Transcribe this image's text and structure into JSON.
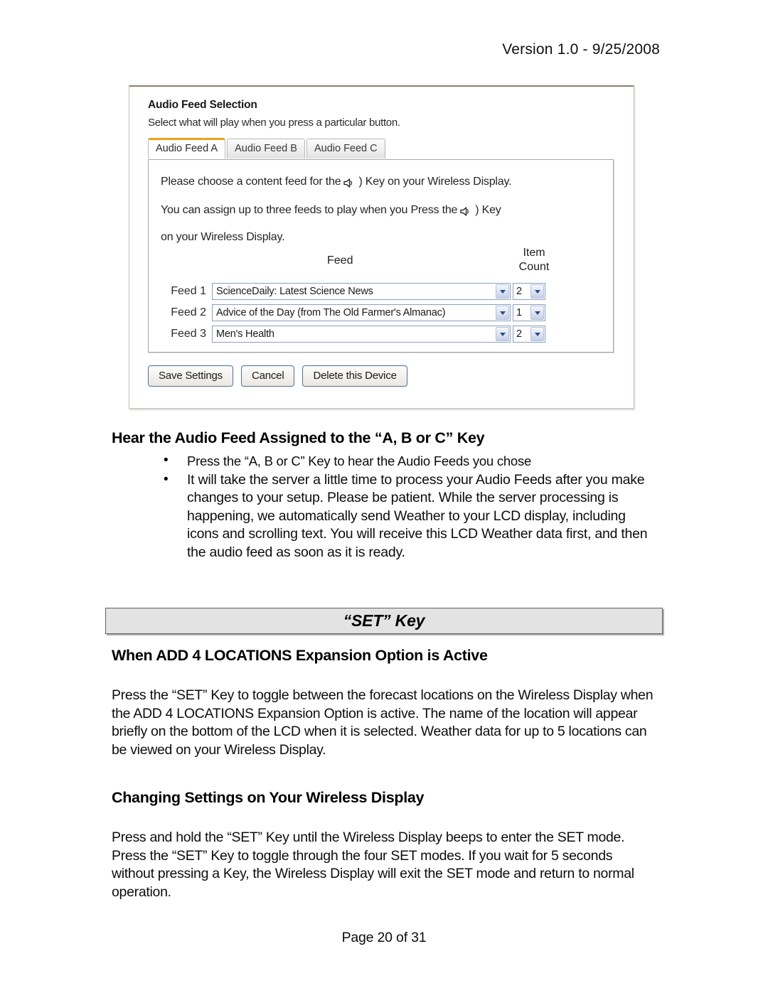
{
  "header": {
    "version_line": "Version 1.0 - 9/25/2008"
  },
  "screenshot_panel": {
    "title": "Audio Feed Selection",
    "subtitle": "Select what will play when you press a particular button.",
    "tabs": [
      {
        "label": "Audio Feed A",
        "active": true
      },
      {
        "label": "Audio Feed B",
        "active": false
      },
      {
        "label": "Audio Feed C",
        "active": false
      }
    ],
    "intro": {
      "line1_before": "Please choose a content feed for the",
      "line1_after": ") Key on your Wireless Display.",
      "line2_before": "You can assign up to three feeds to play when you Press the",
      "line2_after": ") Key",
      "line3": "on your Wireless Display."
    },
    "table": {
      "header_feed": "Feed",
      "header_count": "Item Count",
      "rows": [
        {
          "label": "Feed 1",
          "feed": "ScienceDaily: Latest Science News",
          "count": "2"
        },
        {
          "label": "Feed 2",
          "feed": "Advice of the Day (from The Old Farmer's Almanac)",
          "count": "1"
        },
        {
          "label": "Feed 3",
          "feed": "Men's Health",
          "count": "2"
        }
      ]
    },
    "buttons": {
      "save": "Save Settings",
      "cancel": "Cancel",
      "delete": "Delete this Device"
    },
    "colors": {
      "active_tab_accent": "#f0a11b",
      "panel_border": "#c9c4ae",
      "select_border": "#8ba0bf",
      "button_border": "#4f6f9c"
    }
  },
  "sections": {
    "audio_feed_heading": "Hear the Audio Feed Assigned to the “A, B or C” Key",
    "audio_feed_bullets": [
      "Press the “A, B or C” Key to hear the Audio Feeds  you chose",
      "It will take the server a little time to process your Audio Feeds after you make changes to your setup.  Please be patient.  While the server processing is happening, we automatically send Weather to your LCD display, including icons and scrolling text.  You will receive this LCD Weather data first, and then the audio feed as soon as it is ready."
    ],
    "set_key_banner": "“SET” Key",
    "add4_heading": "When ADD 4 LOCATIONS Expansion Option is Active",
    "set_paragraph": "Press the “SET” Key to toggle between the forecast locations on the Wireless Display when the ADD 4 LOCATIONS Expansion Option is active. The name of the location will appear briefly on the bottom of the LCD when it is selected. Weather data for up to 5 locations can be viewed on your Wireless Display.",
    "changing_settings_heading": "Changing Settings on Your Wireless Display",
    "changing_settings_paragraph": "Press and hold the “SET” Key until the Wireless Display beeps to enter the SET mode. Press the “SET” Key to toggle through the four SET modes.  If you wait for 5 seconds without pressing a Key, the Wireless Display will exit the SET mode and return to normal operation."
  },
  "footer": {
    "page_label": "Page 20 of 31"
  }
}
